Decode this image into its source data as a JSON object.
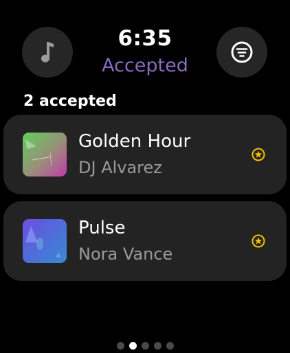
{
  "header": {
    "time": "6:35",
    "title": "Accepted",
    "left_icon": "music-note-icon",
    "right_icon": "filter-list-icon"
  },
  "summary": {
    "count_label": "2 accepted"
  },
  "tracks": [
    {
      "title": "Golden Hour",
      "artist": "DJ Alvarez",
      "badge_icon": "star-icon"
    },
    {
      "title": "Pulse",
      "artist": "Nora Vance",
      "badge_icon": "star-icon"
    }
  ],
  "pager": {
    "count": 5,
    "active_index": 1
  },
  "colors": {
    "accent": "#8a6cc4",
    "star": "#f5c400",
    "card": "#232323",
    "button": "#262626"
  }
}
